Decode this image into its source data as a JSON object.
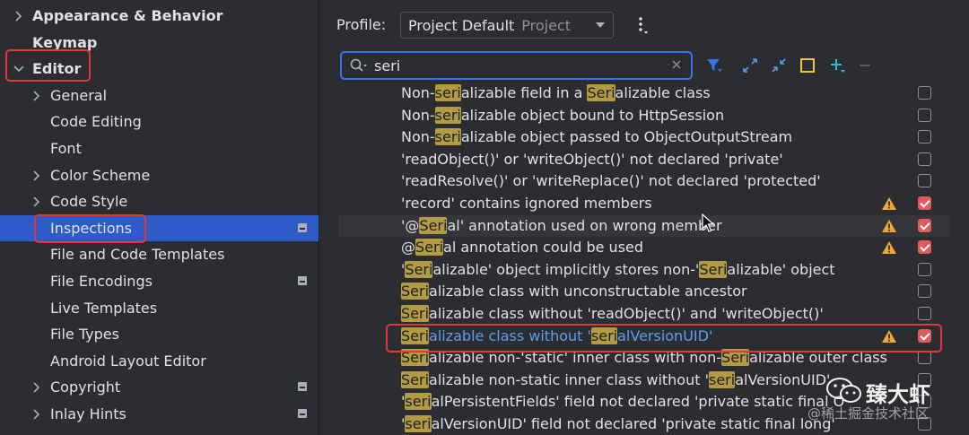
{
  "sidebar": {
    "items": [
      {
        "label": "Appearance & Behavior",
        "level": 0,
        "arrow": "right",
        "bold": true
      },
      {
        "label": "Keymap",
        "level": 0,
        "arrow": "none",
        "bold": true
      },
      {
        "label": "Editor",
        "level": 0,
        "arrow": "down",
        "bold": true
      },
      {
        "label": "General",
        "level": 1,
        "arrow": "right"
      },
      {
        "label": "Code Editing",
        "level": 1,
        "arrow": "none"
      },
      {
        "label": "Font",
        "level": 1,
        "arrow": "none"
      },
      {
        "label": "Color Scheme",
        "level": 1,
        "arrow": "right"
      },
      {
        "label": "Code Style",
        "level": 1,
        "arrow": "right"
      },
      {
        "label": "Inspections",
        "level": 1,
        "arrow": "none",
        "selected": true,
        "badge": true
      },
      {
        "label": "File and Code Templates",
        "level": 1,
        "arrow": "none"
      },
      {
        "label": "File Encodings",
        "level": 1,
        "arrow": "none",
        "badge": true
      },
      {
        "label": "Live Templates",
        "level": 1,
        "arrow": "none"
      },
      {
        "label": "File Types",
        "level": 1,
        "arrow": "none"
      },
      {
        "label": "Android Layout Editor",
        "level": 1,
        "arrow": "none"
      },
      {
        "label": "Copyright",
        "level": 1,
        "arrow": "right",
        "badge": true
      },
      {
        "label": "Inlay Hints",
        "level": 1,
        "arrow": "right",
        "badge": true
      }
    ]
  },
  "profile": {
    "label": "Profile:",
    "value": "Project Default",
    "scope": "Project"
  },
  "search": {
    "value": "seri"
  },
  "inspections": [
    {
      "parts": [
        "Non-",
        {
          "h": "seri"
        },
        "alizable field in a ",
        {
          "h": "Seri"
        },
        "alizable class"
      ],
      "checked": false,
      "warn": false
    },
    {
      "parts": [
        "Non-",
        {
          "h": "seri"
        },
        "alizable object bound to HttpSession"
      ],
      "checked": false,
      "warn": false
    },
    {
      "parts": [
        "Non-",
        {
          "h": "seri"
        },
        "alizable object passed to ObjectOutputStream"
      ],
      "checked": false,
      "warn": false
    },
    {
      "parts": [
        "'readObject()' or 'writeObject()' not declared 'private'"
      ],
      "checked": false,
      "warn": false
    },
    {
      "parts": [
        "'readResolve()' or 'writeReplace()' not declared 'protected'"
      ],
      "checked": false,
      "warn": false
    },
    {
      "parts": [
        "'record' contains ignored members"
      ],
      "checked": true,
      "warn": true
    },
    {
      "parts": [
        "'@",
        {
          "h": "Seri"
        },
        "al' annotation used on wrong member"
      ],
      "checked": true,
      "warn": true,
      "hover": true
    },
    {
      "parts": [
        "@",
        {
          "h": "Seri"
        },
        "al annotation could be used"
      ],
      "checked": true,
      "warn": true
    },
    {
      "parts": [
        "'",
        {
          "h": "Seri"
        },
        "alizable' object implicitly stores non-'",
        {
          "h": "Seri"
        },
        "alizable' object"
      ],
      "checked": false,
      "warn": false
    },
    {
      "parts": [
        {
          "h": "Seri"
        },
        "alizable class with unconstructable ancestor"
      ],
      "checked": false,
      "warn": false
    },
    {
      "parts": [
        {
          "h": "Seri"
        },
        "alizable class without 'readObject()' and 'writeObject()'"
      ],
      "checked": false,
      "warn": false
    },
    {
      "parts": [
        {
          "h": "Seri"
        },
        "alizable class without '",
        {
          "h": "seri"
        },
        "alVersionUID'"
      ],
      "checked": true,
      "warn": true,
      "link": true
    },
    {
      "parts": [
        {
          "h": "Seri"
        },
        "alizable non-'static' inner class with non-",
        {
          "h": "Seri"
        },
        "alizable outer class"
      ],
      "checked": false,
      "warn": false
    },
    {
      "parts": [
        {
          "h": "Seri"
        },
        "alizable non-static inner class without '",
        {
          "h": "seri"
        },
        "alVersionUID'"
      ],
      "checked": false,
      "warn": false
    },
    {
      "parts": [
        "'",
        {
          "h": "seri"
        },
        "alPersistentFields' field not declared 'private static final O"
      ],
      "checked": false,
      "warn": false
    },
    {
      "parts": [
        "'",
        {
          "h": "seri"
        },
        "alVersionUID' field not declared 'private static final long'"
      ],
      "checked": false,
      "warn": false
    }
  ],
  "watermark": {
    "brand": "臻大虾",
    "sub": "@稀土掘金技术社区"
  },
  "colors": {
    "accent": "#3574f0",
    "selection": "#2e5bc8",
    "highlight": "#b39b45",
    "annotation": "#e0383a",
    "warning": "#f0a732"
  }
}
